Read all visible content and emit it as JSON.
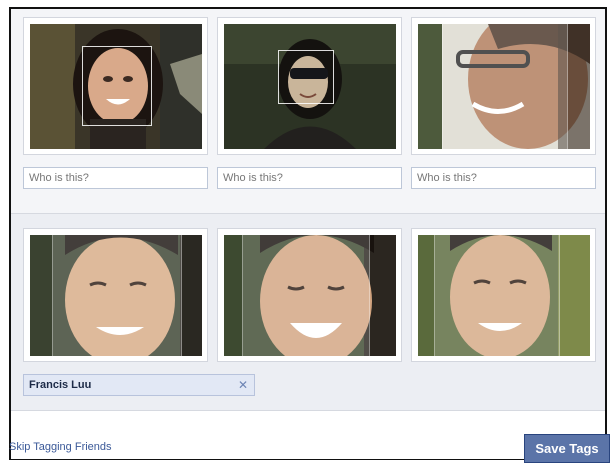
{
  "photos_untagged": [
    {
      "input_placeholder": "Who is this?"
    },
    {
      "input_placeholder": "Who is this?"
    },
    {
      "input_placeholder": "Who is this?"
    }
  ],
  "photos_tagged": {
    "tag_name": "Francis Luu",
    "remove_glyph": "✕"
  },
  "footer": {
    "skip_label": "Skip Tagging Friends",
    "save_label": "Save Tags"
  },
  "colors": {
    "link": "#3b5998",
    "button_bg": "#5b74a8",
    "tag_bg": "#e2e8f5"
  },
  "icons": {
    "remove_tag": "close-icon"
  }
}
